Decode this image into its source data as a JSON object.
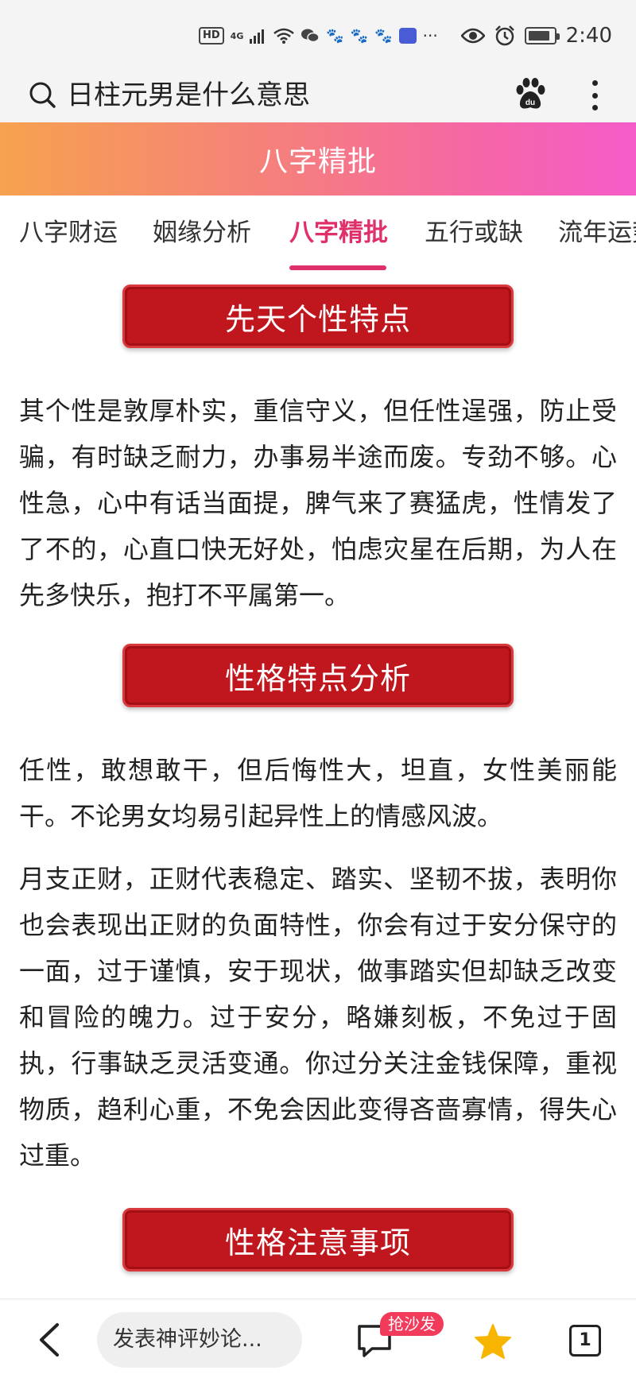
{
  "status_bar": {
    "hd": "HD",
    "signal": "4G",
    "time": "2:40",
    "more": "···"
  },
  "search": {
    "query": "日柱元男是什么意思"
  },
  "banner": {
    "title": "八字精批"
  },
  "tabs": [
    {
      "label": "八字财运",
      "active": false
    },
    {
      "label": "姻缘分析",
      "active": false
    },
    {
      "label": "八字精批",
      "active": true
    },
    {
      "label": "五行或缺",
      "active": false
    },
    {
      "label": "流年运势",
      "active": false
    }
  ],
  "sections": [
    {
      "title": "先天个性特点",
      "paragraphs": [
        "其个性是敦厚朴实，重信守义，但任性逞强，防止受骗，有时缺乏耐力，办事易半途而废。专劲不够。心性急，心中有话当面提，脾气来了赛猛虎，性情发了了不的，心直口快无好处，怕虑灾星在后期，为人在先多快乐，抱打不平属第一。"
      ]
    },
    {
      "title": "性格特点分析",
      "paragraphs": [
        "任性，敢想敢干，但后悔性大，坦直，女性美丽能干。不论男女均易引起异性上的情感风波。",
        "月支正财，正财代表稳定、踏实、坚韧不拔，表明你也会表现出正财的负面特性，你会有过于安分保守的一面，过于谨慎，安于现状，做事踏实但却缺乏改变和冒险的魄力。过于安分，略嫌刻板，不免过于固执，行事缺乏灵活变通。你过分关注金钱保障，重视物质，趋利心重，不免会因此变得吝啬寡情，得失心过重。"
      ]
    },
    {
      "title": "性格注意事项",
      "paragraphs": []
    }
  ],
  "bottom_bar": {
    "comment_placeholder": "发表神评妙论...",
    "sofa_badge": "抢沙发",
    "tabs_count": "1"
  },
  "colors": {
    "accent": "#e0306a",
    "section_red": "#c0161d",
    "banner_start": "#f6a24e",
    "banner_end": "#f45cc8"
  },
  "icons": [
    "search-icon",
    "baidu-paw-icon",
    "more-vertical-icon",
    "back-icon",
    "comment-icon",
    "star-icon",
    "tabs-icon"
  ]
}
